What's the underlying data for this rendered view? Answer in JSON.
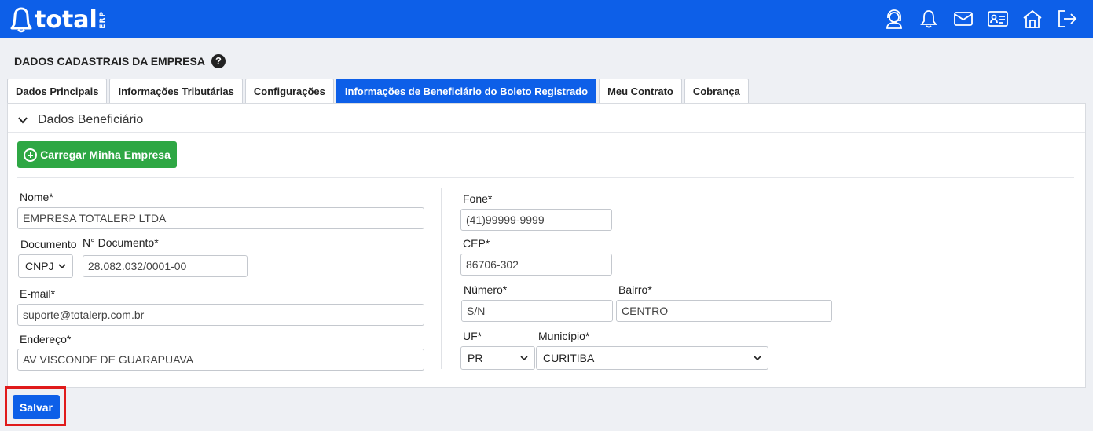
{
  "header": {
    "logo_text": "total",
    "logo_suffix": "ERP",
    "icons": [
      "support-agent-icon",
      "bell-icon",
      "mail-icon",
      "id-card-icon",
      "home-icon",
      "logout-icon"
    ]
  },
  "page": {
    "title": "DADOS CADASTRAIS DA EMPRESA",
    "help": "?"
  },
  "tabs": [
    {
      "label": "Dados Principais",
      "active": false
    },
    {
      "label": "Informações Tributárias",
      "active": false
    },
    {
      "label": "Configurações",
      "active": false
    },
    {
      "label": "Informações de Beneficiário do Boleto Registrado",
      "active": true
    },
    {
      "label": "Meu Contrato",
      "active": false
    },
    {
      "label": "Cobrança",
      "active": false
    }
  ],
  "section": {
    "title": "Dados Beneficiário",
    "load_button": "Carregar Minha Empresa"
  },
  "form": {
    "nome": {
      "label": "Nome*",
      "value": "EMPRESA TOTALERP LTDA"
    },
    "documento": {
      "label": "Documento",
      "value": "CNPJ"
    },
    "num_documento": {
      "label": "N° Documento*",
      "value": "28.082.032/0001-00"
    },
    "email": {
      "label": "E-mail*",
      "value": "suporte@totalerp.com.br"
    },
    "endereco": {
      "label": "Endereço*",
      "value": "AV VISCONDE DE GUARAPUAVA"
    },
    "fone": {
      "label": "Fone*",
      "value": "(41)99999-9999"
    },
    "cep": {
      "label": "CEP*",
      "value": "86706-302"
    },
    "numero": {
      "label": "Número*",
      "value": "S/N"
    },
    "bairro": {
      "label": "Bairro*",
      "value": "CENTRO"
    },
    "uf": {
      "label": "UF*",
      "value": "PR"
    },
    "municipio": {
      "label": "Município*",
      "value": "CURITIBA"
    }
  },
  "footer": {
    "save_label": "Salvar"
  },
  "colors": {
    "brand_blue": "#0d5fe8",
    "green": "#2ea744",
    "highlight_red": "#e01b1b"
  }
}
